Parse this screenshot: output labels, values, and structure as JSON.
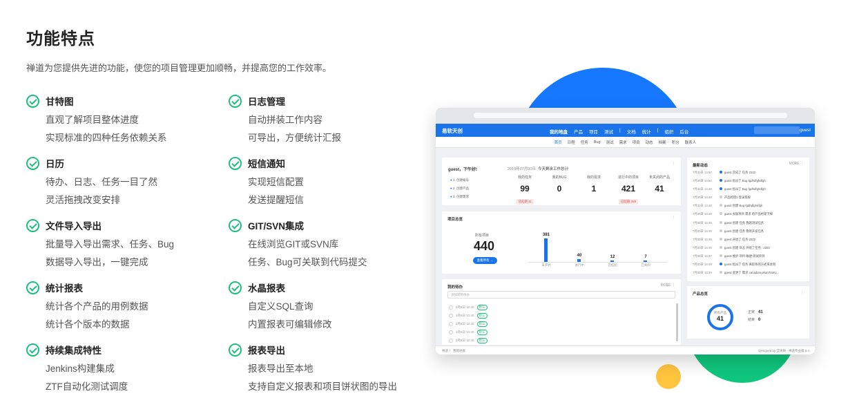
{
  "page": {
    "title": "功能特点",
    "subtitle": "禅道为您提供先进的功能，使您的项目管理更加顺畅，并提高您的工作效率。"
  },
  "features": [
    {
      "title": "甘特图",
      "lines": [
        "直观了解项目整体进度",
        "实现标准的四种任务依赖关系"
      ]
    },
    {
      "title": "日志管理",
      "lines": [
        "自动拼装工作内容",
        "可导出，方便统计汇报"
      ]
    },
    {
      "title": "日历",
      "lines": [
        "待办、日志、任务一目了然",
        "灵活拖拽改变安排"
      ]
    },
    {
      "title": "短信通知",
      "lines": [
        "实现短信配置",
        "发送提醒短信"
      ]
    },
    {
      "title": "文件导入导出",
      "lines": [
        "批量导入导出需求、任务、Bug",
        "数据导入导出，一键完成"
      ]
    },
    {
      "title": "GIT/SVN集成",
      "lines": [
        "在线浏览GIT或SVN库",
        "任务、Bug可关联到代码提交"
      ]
    },
    {
      "title": "统计报表",
      "lines": [
        "统计各个产品的用例数据",
        "统计各个版本的数据"
      ]
    },
    {
      "title": "水晶报表",
      "lines": [
        "自定义SQL查询",
        "内置报表可编辑修改"
      ]
    },
    {
      "title": "持续集成特性",
      "lines": [
        "Jenkins构建集成",
        "ZTF自动化测试调度"
      ]
    },
    {
      "title": "报表导出",
      "lines": [
        "报表导出至本地",
        "支持自定义报表和项目饼状图的导出"
      ]
    }
  ],
  "mock": {
    "logo": "易软天创",
    "nav": [
      "我的地盘",
      "产品",
      "项目",
      "测试",
      "|",
      "文档",
      "统计",
      "|",
      "组织",
      "后台"
    ],
    "search_btn": "GO!",
    "user": "guest",
    "subnav": [
      "首页",
      "日程",
      "任务",
      "Bug",
      "测试",
      "需求",
      "项目",
      "动态",
      "档案",
      "积分",
      "联系人"
    ],
    "welcome": {
      "greeting": "guest，下午好!",
      "date": "2019年07月30日",
      "summary": "今天剩余工作总计",
      "steps": [
        "1. 创建帐号",
        "2. 创建产品",
        "3. 创建需求"
      ],
      "stats": [
        {
          "label": "我的任务",
          "value": "99",
          "tag": "已延期 11"
        },
        {
          "label": "我的BUG",
          "value": "0",
          "tag": ""
        },
        {
          "label": "我的需求",
          "value": "1",
          "tag": ""
        },
        {
          "label": "进行中的项目",
          "value": "421",
          "tag": "已延期 389"
        },
        {
          "label": "未关闭的产品",
          "value": "41",
          "tag": ""
        }
      ]
    },
    "projects": {
      "title": "项目总览",
      "total_label": "所有项目",
      "total": "440",
      "btn": "查看所有 →",
      "chart_data": {
        "type": "bar",
        "categories": [
          "未开始",
          "进行中",
          "已挂起",
          "已关闭"
        ],
        "values": [
          381,
          40,
          12,
          7
        ]
      }
    },
    "todo": {
      "title": "我的待办",
      "more": "MORE",
      "placeholder": "添加新的待办",
      "rows": [
        "1月8日 12:40",
        "1月8日 12:40",
        "1月8日 12:40",
        "1月8日 12:40",
        "1月8日 12:40"
      ],
      "tag": "默认"
    },
    "dynamics": {
      "title": "最新动态",
      "more": "MORE",
      "rows": [
        {
          "time": "7月30日 14:50",
          "text": "guest 完成了 任务 2222",
          "hl": true
        },
        {
          "time": "7月30日 14:50",
          "text": "guest 指派了 Bug fgdhdfghdfgh",
          "hl": true
        },
        {
          "time": "7月30日 14:49",
          "text": "guest 指派了 Bug fgdhdfghdfgh",
          "hl": true
        },
        {
          "time": "7月30日 14:49",
          "text": "产品经理1 登录系统",
          "hl": false
        },
        {
          "time": "7月30日 14:48",
          "text": "guest 创建 Bug fgdhdfghdfgh",
          "hl": false
        },
        {
          "time": "7月30日 14:48",
          "text": "guest 关联项目 需求 给产品经理下掉",
          "hl": false
        },
        {
          "time": "7月30日 14:48",
          "text": "guest 创建 任务 我的测试任务",
          "hl": false
        },
        {
          "time": "7月30日 14:48",
          "text": "guest 创建 任务 我的开发任务",
          "hl": false
        },
        {
          "time": "7月30日 14:48",
          "text": "guest 开始了 任务 2222",
          "hl": false
        },
        {
          "time": "7月30日 14:48",
          "text": "guest 创建 日志 开始了任务 : 2222",
          "hl": false
        },
        {
          "time": "7月30日 14:47",
          "text": "guest 维护 项目 敏捷-测试项目",
          "hl": false
        },
        {
          "time": "7月30日 14:40",
          "text": "guest 指派了 任务 离职系的方式来进到",
          "hl": true
        },
        {
          "time": "7月30日 14:39",
          "text": "guest 变更了 需求 canadian pharchamy...",
          "hl": false
        }
      ]
    },
    "products": {
      "title": "产品总览",
      "donut_label": "所有产品",
      "donut_value": "41",
      "legend": [
        {
          "label": "正常",
          "value": "41"
        },
        {
          "label": "结束",
          "value": "0"
        }
      ]
    },
    "footer": {
      "left": "禅道 〉 我的地盘",
      "right": "Designed by 艾体铸 · 禅道专业版 8.4"
    }
  }
}
